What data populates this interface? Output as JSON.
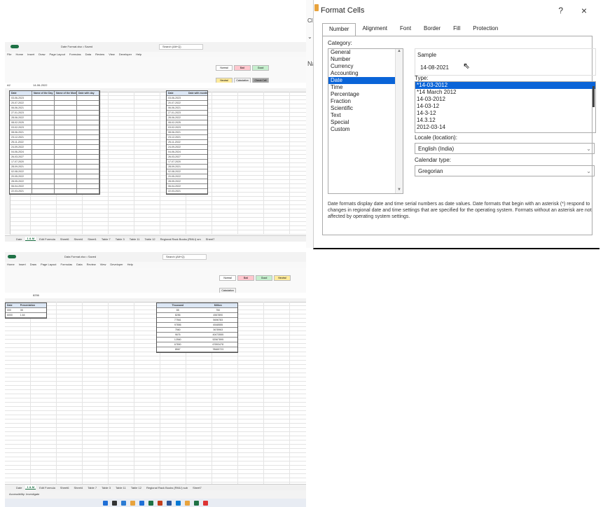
{
  "top_excel": {
    "tabs": [
      "File",
      "Home",
      "Insert",
      "Draw",
      "Page Layout",
      "Formulas",
      "Data",
      "Review",
      "View",
      "Developer",
      "Help"
    ],
    "title": "Date Format.xlsx • Saved",
    "search": "Search (Alt+Q)",
    "name_box": "A2",
    "formula": "14-06-2022",
    "col_headers": [
      "Date",
      "Name of the Day",
      "Name of the Month",
      "Date with day"
    ],
    "dates": [
      "03-06-2023",
      "20-07-2022",
      "06-06-2021",
      "27-01-2023",
      "28-06-2022",
      "08-02-2025",
      "03-02-2023",
      "08-06-2021",
      "23-12-2021",
      "25-11-2022",
      "24-09-2022",
      "04-06-2024",
      "26-03-2027",
      "17-07-2020",
      "28-09-2021",
      "02-08-2022",
      "20-05-2022",
      "28-05-2022",
      "06-04-2022",
      "22-03-2021"
    ],
    "right_header": [
      "Date",
      "Date with month"
    ],
    "sheet_tabs": [
      "Date",
      "1 & M",
      "Edit Formula",
      "Sheet6",
      "Sheet4",
      "Sheet1",
      "Table 7",
      "Table 3",
      "Table 11",
      "Table 12",
      "Regional Rack Books (RMLI) sm",
      "Sheet7"
    ],
    "styles": [
      "Normal",
      "Bad",
      "Good",
      "Neutral",
      "Calculation",
      "Check Cell"
    ]
  },
  "bottom_excel": {
    "tabs": [
      "Home",
      "Insert",
      "Draw",
      "Page Layout",
      "Formulas",
      "Data",
      "Review",
      "View",
      "Developer",
      "Help"
    ],
    "title": "Data Format.xlsx • Saved",
    "search": "Search (Alt+Q)",
    "formula": "8256",
    "left_headers": [
      "Date",
      "Presentation"
    ],
    "left_values": [
      [
        "000",
        "35"
      ],
      [
        "6000",
        "1.64"
      ]
    ],
    "right_headers": [
      "Thousand",
      "Million"
    ],
    "right_rows": [
      [
        "85",
        "750"
      ],
      [
        "8256",
        "4567890"
      ],
      [
        "77561",
        "5696783"
      ],
      [
        "97856",
        "6548555"
      ],
      [
        "7560",
        "3678963"
      ],
      [
        "9676",
        "40673555"
      ],
      [
        "12560",
        "52567895"
      ],
      [
        "67890",
        "67893478"
      ],
      [
        "8567",
        "78665723"
      ]
    ],
    "sheet_tabs": [
      "Date",
      "1 & M",
      "Edit Formula",
      "Sheet6",
      "Sheet4",
      "Table 7",
      "Table 3",
      "Table 11",
      "Table 12",
      "Regional Rack Books (RMLI) sub",
      "Sheet7"
    ],
    "status": "Accessibility: Investigate",
    "styles": [
      "Normal",
      "Bad",
      "Good",
      "Neutral",
      "Calculation"
    ]
  },
  "dialog": {
    "title": "Format Cells",
    "help": "?",
    "close": "×",
    "tabs": [
      "Number",
      "Alignment",
      "Font",
      "Border",
      "Fill",
      "Protection"
    ],
    "category_label": "Category:",
    "categories": [
      "General",
      "Number",
      "Currency",
      "Accounting",
      "Date",
      "Time",
      "Percentage",
      "Fraction",
      "Scientific",
      "Text",
      "Special",
      "Custom"
    ],
    "selected_category": "Date",
    "sample_label": "Sample",
    "sample_value": "14-08-2021",
    "type_label": "Type:",
    "types": [
      "*14-03-2012",
      "*14 March 2012",
      "14-03-2012",
      "14-03-12",
      "14-3-12",
      "14.3.12",
      "2012-03-14"
    ],
    "locale_label": "Locale (location):",
    "locale_value": "English (India)",
    "calendar_label": "Calendar type:",
    "calendar_value": "Gregorian",
    "description": "Date formats display date and time serial numbers as date values. Date formats that begin with an asterisk (*) respond to changes in regional date and time settings that are specified for the operating system. Formats without an asterisk are not affected by operating system settings."
  },
  "background_strip": {
    "letters": [
      "Cl",
      "Nar"
    ]
  },
  "colors": {
    "excel_green": "#1e7145",
    "select_blue": "#0a64d8",
    "header_fill": "#dbe6f4"
  }
}
